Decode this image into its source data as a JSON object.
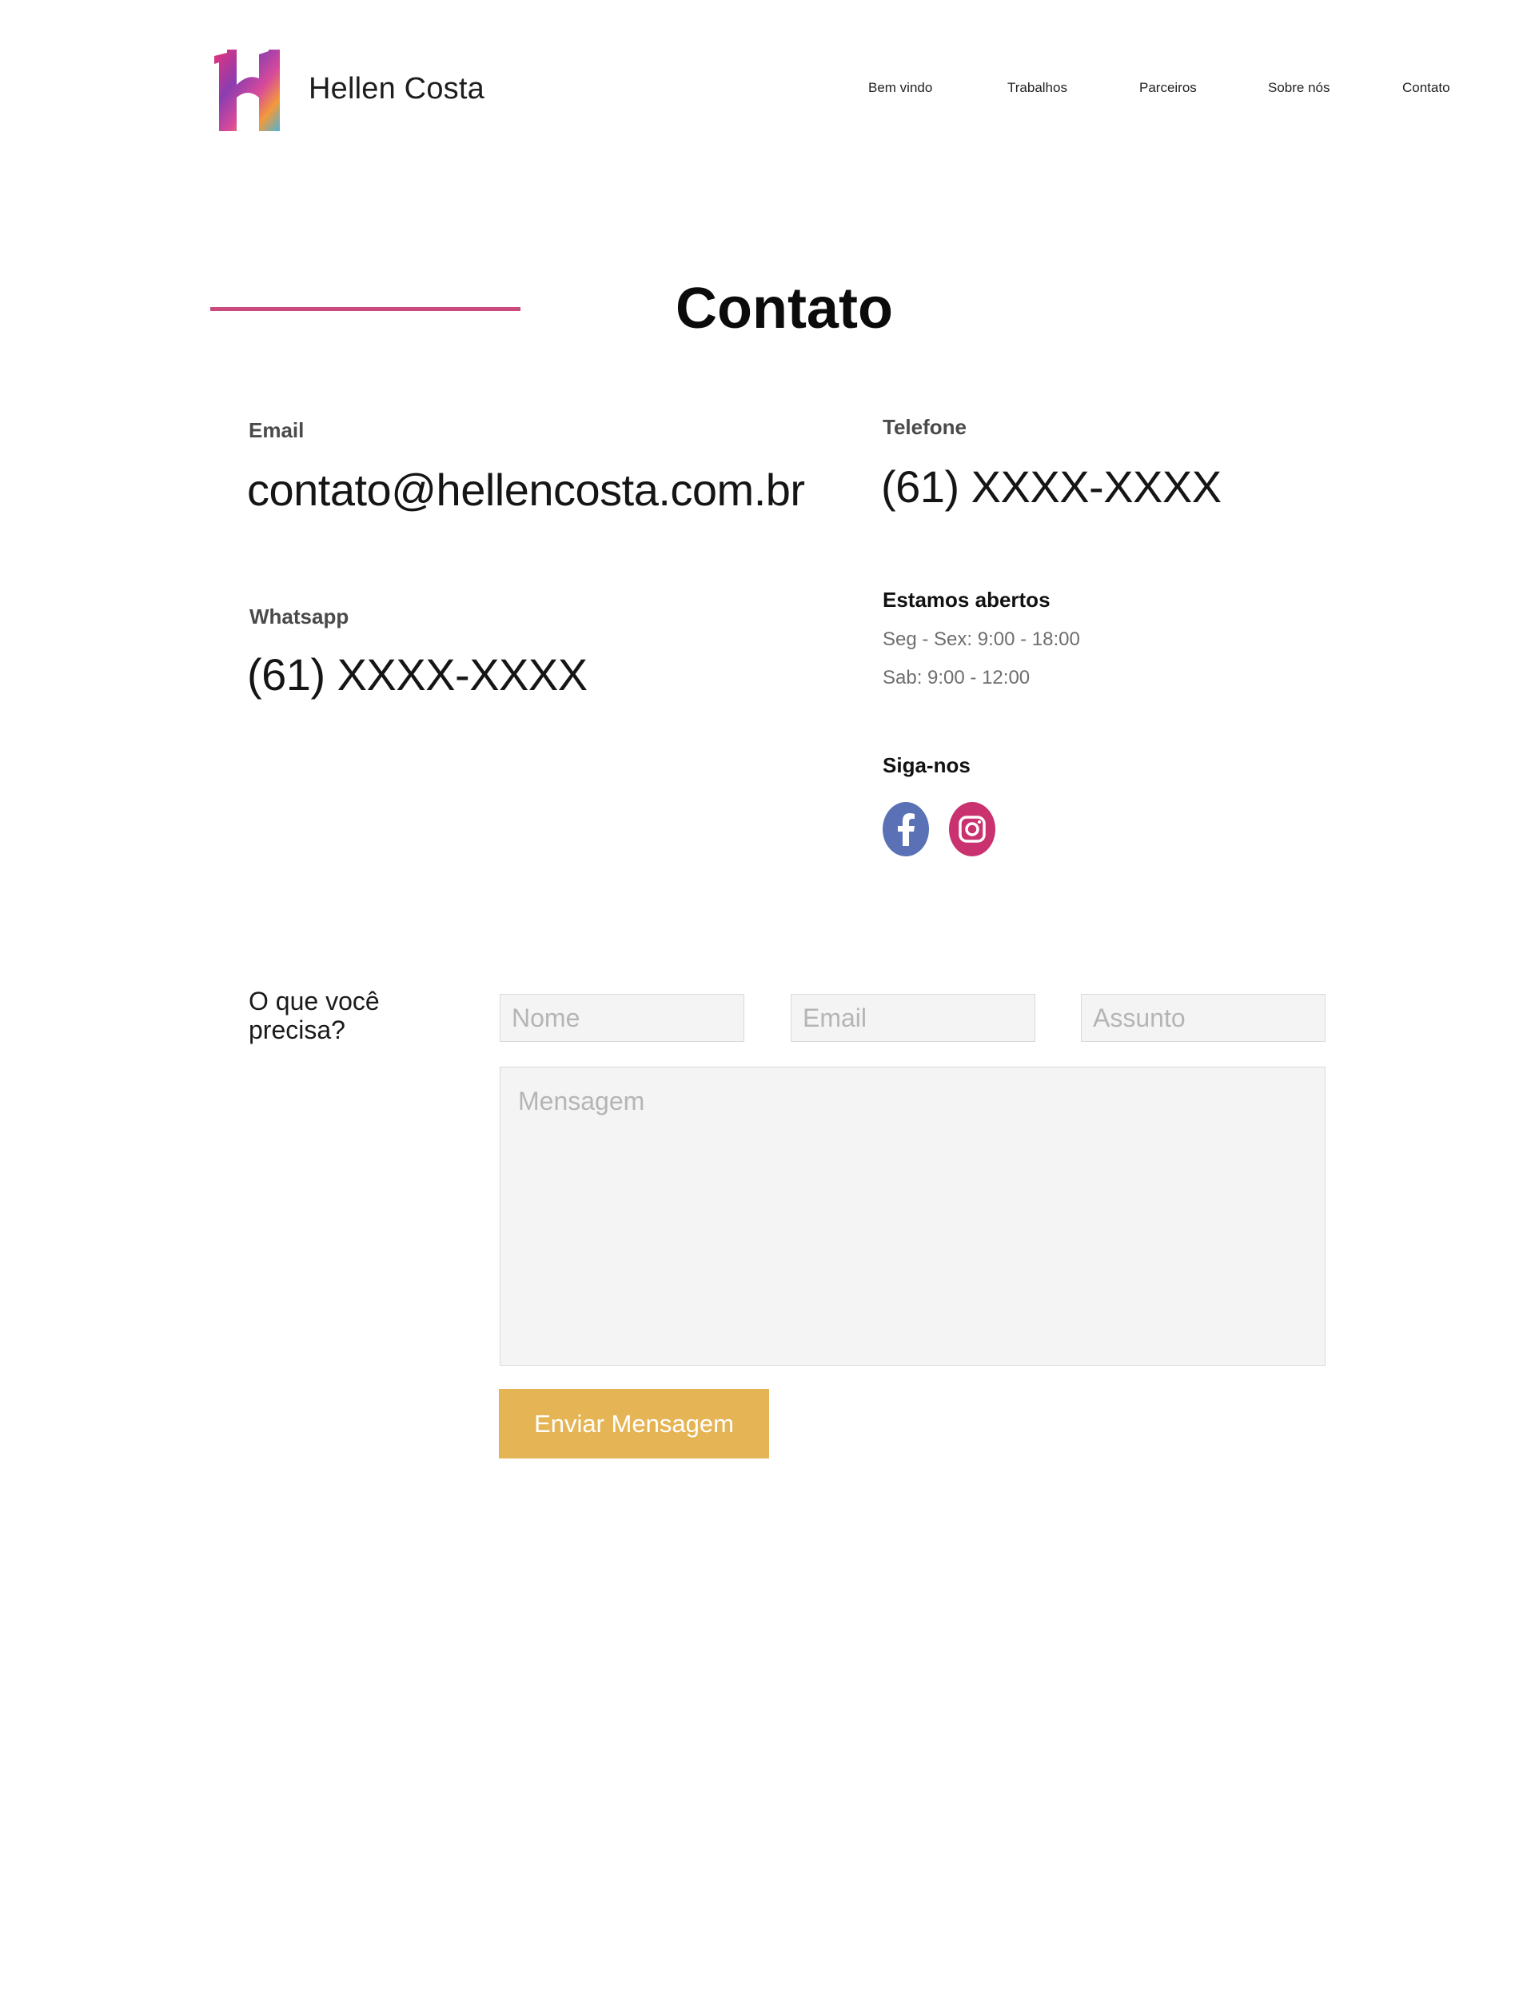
{
  "header": {
    "brand_name": "Hellen Costa",
    "nav": [
      "Bem vindo",
      "Trabalhos",
      "Parceiros",
      "Sobre nós",
      "Contato"
    ]
  },
  "page_title": "Contato",
  "contact": {
    "email_label": "Email",
    "email_value": "contato@hellencosta.com.br",
    "phone_label": "Telefone",
    "phone_value": "(61) XXXX-XXXX",
    "whatsapp_label": "Whatsapp",
    "whatsapp_value": "(61) XXXX-XXXX",
    "hours_label": "Estamos abertos",
    "hours_weekdays": "Seg - Sex: 9:00 - 18:00",
    "hours_saturday": "Sab: 9:00 - 12:00",
    "social_label": "Siga-nos"
  },
  "social": {
    "facebook_icon": "facebook-icon",
    "instagram_icon": "instagram-icon",
    "facebook_color": "#5a72b5",
    "instagram_color": "#c9326f"
  },
  "form": {
    "prompt_line1": "O que você",
    "prompt_line2": "precisa?",
    "name_placeholder": "Nome",
    "email_placeholder": "Email",
    "subject_placeholder": "Assunto",
    "message_placeholder": "Mensagem",
    "submit_label": "Enviar Mensagem"
  },
  "colors": {
    "accent_line": "#c94a7b",
    "button": "#e5b454"
  }
}
